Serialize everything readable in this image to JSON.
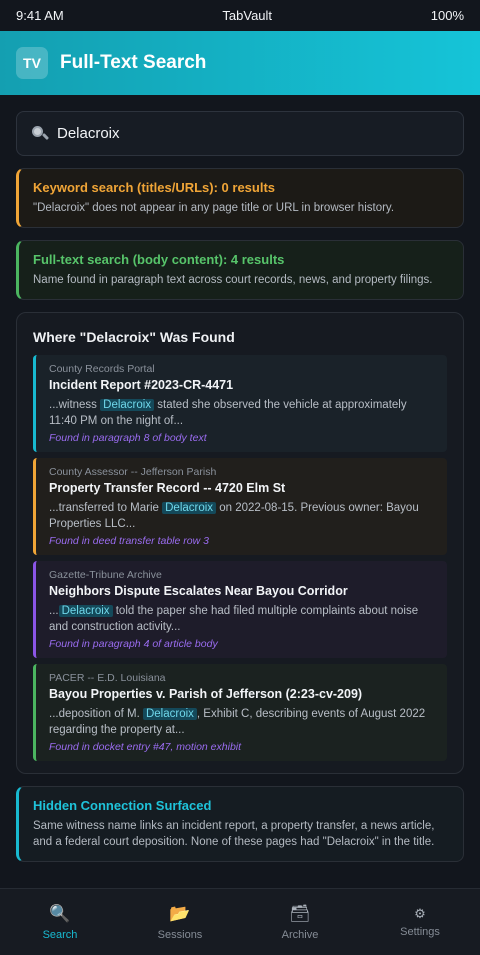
{
  "status_bar": {
    "time": "9:41 AM",
    "app": "TabVault",
    "battery": "100%"
  },
  "header": {
    "logo": "TV",
    "title": "Full-Text Search"
  },
  "search": {
    "value": "Delacroix",
    "icon": "search-icon"
  },
  "keyword_notice": {
    "title": "Keyword search (titles/URLs): 0 results",
    "body": "\"Delacroix\" does not appear in any page title or URL in browser history.",
    "color": "#f0a537"
  },
  "fulltext_notice": {
    "title": "Full-text search (body content): 4 results",
    "body": "Name found in paragraph text across court records, news, and property filings.",
    "color": "#4bb560"
  },
  "results_panel": {
    "title": "Where \"Delacroix\" Was Found",
    "items": [
      {
        "source": "County Records Portal",
        "title": "Incident Report #2023-CR-4471",
        "snippet_before": "...witness ",
        "match": "Delacroix",
        "snippet_after": " stated she observed the vehicle at approximately 11:40 PM on the night of...",
        "location": "Found in paragraph 8 of body text",
        "color": "#18b9d0"
      },
      {
        "source": "County Assessor -- Jefferson Parish",
        "title": "Property Transfer Record -- 4720 Elm St",
        "snippet_before": "...transferred to Marie ",
        "match": "Delacroix",
        "snippet_after": " on 2022-08-15. Previous owner: Bayou Properties LLC...",
        "location": "Found in deed transfer table row 3",
        "color": "#f0a537"
      },
      {
        "source": "Gazette-Tribune Archive",
        "title": "Neighbors Dispute Escalates Near Bayou Corridor",
        "snippet_before": "...",
        "match": "Delacroix",
        "snippet_after": " told the paper she had filed multiple complaints about noise and construction activity...",
        "location": "Found in paragraph 4 of article body",
        "color": "#8b55e6"
      },
      {
        "source": "PACER -- E.D. Louisiana",
        "title": "Bayou Properties v. Parish of Jefferson (2:23-cv-209)",
        "snippet_before": "...deposition of M. ",
        "match": "Delacroix",
        "snippet_after": ", Exhibit C, describing events of August 2022 regarding the property at...",
        "location": "Found in docket entry #47, motion exhibit",
        "color": "#4bb560"
      }
    ]
  },
  "connection_notice": {
    "title": "Hidden Connection Surfaced",
    "body": "Same witness name links an incident report, a property transfer, a news article, and a federal court deposition. None of these pages had \"Delacroix\" in the title.",
    "color": "#18b9d0"
  },
  "nav": [
    {
      "label": "Search",
      "icon": "search-icon",
      "active": true
    },
    {
      "label": "Sessions",
      "icon": "folder-icon",
      "active": false
    },
    {
      "label": "Archive",
      "icon": "archive-box-icon",
      "active": false
    },
    {
      "label": "Settings",
      "icon": "gear-icon",
      "active": false
    }
  ]
}
